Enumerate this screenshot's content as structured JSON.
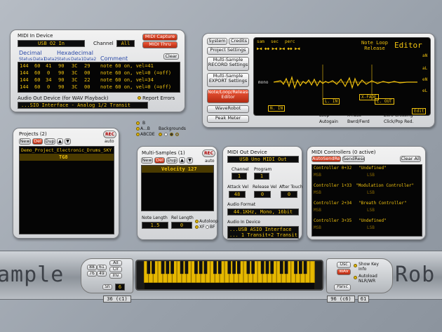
{
  "midi_in": {
    "title": "MIDI In Device",
    "device": "USB O2 In",
    "channel_label": "Channel",
    "channel_value": "All",
    "capture": "MIDI Capture",
    "thru": "MIDI Thru",
    "clear": "Clear",
    "col_decimal": "Decimal",
    "col_hexadecimal": "Hexadecimal",
    "col_comment": "Comment",
    "sub_cols": [
      "Status",
      "Data1",
      "Data2",
      "Status",
      "Data1",
      "Data2"
    ],
    "rows": [
      {
        "d": [
          "144",
          "60",
          "41"
        ],
        "h": [
          "90",
          "3C",
          "29"
        ],
        "c": "note 60 on, vel=41"
      },
      {
        "d": [
          "144",
          "60",
          "0"
        ],
        "h": [
          "90",
          "3C",
          "00"
        ],
        "c": "note 60 on, vel=0 (=off)"
      },
      {
        "d": [
          "144",
          "60",
          "34"
        ],
        "h": [
          "90",
          "3C",
          "22"
        ],
        "c": "note 60 on, vel=34"
      },
      {
        "d": [
          "144",
          "60",
          "0"
        ],
        "h": [
          "90",
          "3C",
          "00"
        ],
        "c": "note 60 on, vel=0 (=off)"
      }
    ],
    "audio_out_label": "Audio Out Device (for WAV Playback)",
    "audio_out_device": "...SIO Interface - Analog 1/2 Transit",
    "report_errors": "Report Errors"
  },
  "settings_menu": [
    "System",
    "Credits",
    "Project Settings",
    "Multi-Sample RECORD Settings",
    "Multi-Sample EXPORT Settings",
    "Note/Loop/Release Editor",
    "WaveRobot",
    "Peak Meter"
  ],
  "editor": {
    "title": "Editor",
    "mode": "Note Loop Release",
    "flags": [
      "sam",
      "sec",
      "perc"
    ],
    "mono": "mono",
    "markers": [
      "N. IN",
      "L. IN",
      "X-FADE",
      "L. OUT"
    ],
    "side_buttons": [
      "aN",
      "aL",
      "eN",
      "eL"
    ],
    "checks": [
      "Loop",
      "X-Fade",
      "Zero Crossing",
      "Autogain",
      "Bwrd/Fwrd",
      "Click/Pop Red."
    ],
    "edit": "Edit"
  },
  "projects": {
    "title": "Projects (2)",
    "rec": "REC",
    "auto": "auto",
    "buttons": [
      "New",
      "Del",
      "Dup"
    ],
    "items": [
      "Demo_Project_Electronic_Drums_SKY",
      "TG8"
    ]
  },
  "legend": {
    "items": [
      "B",
      "A...B",
      "ABCDE"
    ],
    "backgrounds": "Backgrounds"
  },
  "multisamples": {
    "title": "Multi-Samples (1)",
    "rec": "REC",
    "auto": "auto",
    "buttons": [
      "New",
      "Del",
      "Dup"
    ],
    "items": [
      "Velocity 127"
    ],
    "note_length_label": "Note Length",
    "rel_length_label": "Rel Length",
    "note_length": "1.5",
    "rel_length": "0",
    "autoloop": "Autoloop",
    "xf": "XF",
    "bf": "BF"
  },
  "midi_out": {
    "title": "MIDI Out Device",
    "device": "USB Uno MIDI Out",
    "channel_label": "Channel",
    "program_label": "Program",
    "channel": "1",
    "program": "1",
    "attack_label": "Attack Vel",
    "release_label": "Release Vel",
    "aftertouch_label": "After Touch",
    "attack": "48",
    "release": "0",
    "aftertouch": "0",
    "audio_format_label": "Audio Format",
    "audio_format": "44.1KHz, Mono, 16bit",
    "audio_in_label": "Audio In Device",
    "audio_in_1": "...USB ASIO Interface",
    "audio_in_2": "... 1 Transit+2 Transit"
  },
  "midi_controllers": {
    "title": "MIDI Controllers (0 active)",
    "auto_send_reset": "AutoSendReset",
    "send_reset": "SendReset",
    "clear_all": "Clear All",
    "msb": "MSB",
    "lsb": "LSB",
    "items": [
      {
        "name": "Controller 0+32",
        "desc": "\"Undefined\""
      },
      {
        "name": "Controller 1+33",
        "desc": "\"Modulation Controller\""
      },
      {
        "name": "Controller 2+34",
        "desc": "\"Breath Controller\""
      },
      {
        "name": "Controller 3+35",
        "desc": "\"Undefined\""
      }
    ]
  },
  "keyboard": {
    "left_big": "ample",
    "right_big": "Rob",
    "left_buttons": [
      "All",
      "Clr",
      "Inv",
      "Sh"
    ],
    "left_numbers": [
      "88",
      "76",
      "61",
      "49"
    ],
    "step": "6",
    "left_readout": "36 (c1)",
    "right_buttons": [
      "Osc",
      "WAV",
      "Panic"
    ],
    "show_key_info": "Show Key Info",
    "autoload": "Autoload NLR/WR",
    "right_readout": "96 (c6)",
    "right_step": "61"
  }
}
